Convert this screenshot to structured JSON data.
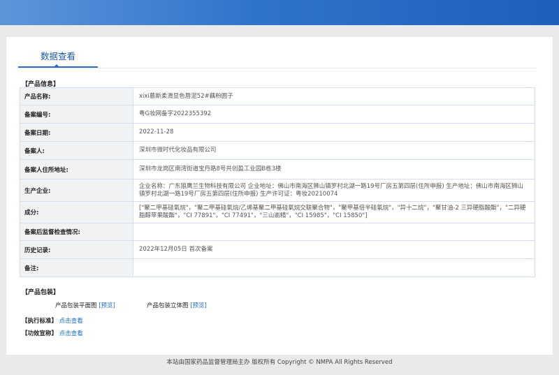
{
  "tab": {
    "label": "数据查看"
  },
  "sections": {
    "product_info": "【产品信息】",
    "product_package": "【产品包装】",
    "exec_standard": "【执行标准】",
    "efficacy": "【功效宣称】"
  },
  "info_rows": [
    {
      "label": "产品名称:",
      "value": "xixi慕斯柔滑显色唇泥52#藕粉圆子"
    },
    {
      "label": "备案编号:",
      "value": "粤G妆网备字2022355392"
    },
    {
      "label": "备案日期:",
      "value": "2022-11-28"
    },
    {
      "label": "备案人:",
      "value": "深圳市微时代化妆品有限公司"
    },
    {
      "label": "备案人住所地址:",
      "value": "深圳市龙岗区南湾街道宝丹路8号共创盈工业园B栋3楼"
    },
    {
      "label": "生产企业:",
      "value": "企业名称：广东狼鹰兰生物科技有限公司 企业地址：佛山市南海区狮山镇罗村北湖一路19号厂房五第四层(住所申报) 生产地址：佛山市南海区狮山镇罗村北湖一路19号厂房五第四层(住所申报) 生产许可证：粤妆20210074"
    },
    {
      "label": "成分:",
      "value": "[\"聚二甲基硅氧烷\"，\"聚二甲基硅氧烷/乙烯基聚二甲基硅氧烷交联聚合物\"，\"聚甲基倍半硅氧烷\"，\"异十二烷\"，\"聚甘油-2 三异硬脂酸酯\"，\"二异硬脂醇苹果酸酯\"，\"CI 77891\"，\"CI 77491\"，\"三山嵛精\"，\"CI 15985\"，\"CI 15850\"]"
    },
    {
      "label": "备案后监督检查情况:",
      "value": ""
    },
    {
      "label": "历史记录:",
      "value": "2022年12月05日 首次备案"
    },
    {
      "label": "备注:",
      "value": ""
    }
  ],
  "package": {
    "flat_label": "产品包装平面图",
    "flat_link": "[预览]",
    "solid_label": "产品包装立体图",
    "solid_link": "[预览]"
  },
  "links": {
    "exec_standard": "点击查看",
    "efficacy": "点击查看"
  },
  "footer": {
    "text": "本站由国家药品监督管理局主办 版权所有 Copyright © NMPA All Rights Reserved"
  },
  "colors": {
    "banner": "#2f74cc",
    "link": "#1d6cc6",
    "tab_active": "#2b6cc4",
    "label_bg": "#f1f2f4"
  }
}
